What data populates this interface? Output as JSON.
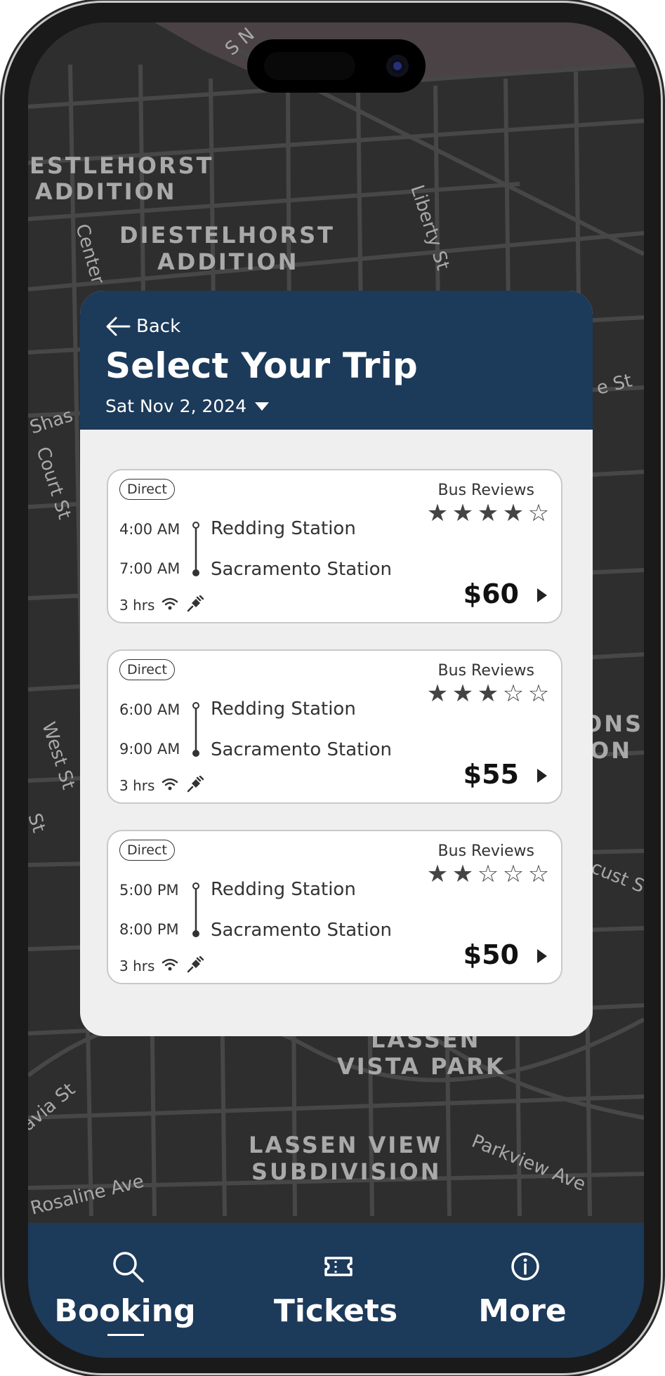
{
  "header": {
    "back_label": "Back",
    "title": "Select Your Trip",
    "date": "Sat Nov 2, 2024"
  },
  "map_labels": {
    "l1": "ESTLEHORST",
    "l2": "ADDITION",
    "l3": "DIESTELHORST",
    "l4": "ADDITION",
    "l5": "Liberty St",
    "l6": "Center",
    "l7": "Shas",
    "l8": "Court St",
    "l9": "West St",
    "l10": "St",
    "l11": "ONS",
    "l12": "ON",
    "l13": "cust S",
    "l14": "e St",
    "l15": "LASSEN",
    "l16": "VISTA PARK",
    "l17": "LASSEN VIEW",
    "l18": "SUBDIVISION",
    "l19": "avia St",
    "l20": "Rosaline Ave",
    "l21": "Parkview Ave",
    "l22": "S N"
  },
  "trips": [
    {
      "badge": "Direct",
      "depart_time": "4:00 AM",
      "arrive_time": "7:00 AM",
      "origin": "Redding Station",
      "destination": "Sacramento Station",
      "duration": "3 hrs",
      "reviews_label": "Bus Reviews",
      "rating": 4,
      "price": "$60"
    },
    {
      "badge": "Direct",
      "depart_time": "6:00 AM",
      "arrive_time": "9:00 AM",
      "origin": "Redding Station",
      "destination": "Sacramento Station",
      "duration": "3 hrs",
      "reviews_label": "Bus Reviews",
      "rating": 3,
      "price": "$55"
    },
    {
      "badge": "Direct",
      "depart_time": "5:00 PM",
      "arrive_time": "8:00 PM",
      "origin": "Redding Station",
      "destination": "Sacramento Station",
      "duration": "3 hrs",
      "reviews_label": "Bus Reviews",
      "rating": 2,
      "price": "$50"
    }
  ],
  "nav": {
    "booking": "Booking",
    "tickets": "Tickets",
    "more": "More",
    "active": "Booking"
  },
  "icons": {
    "back": "arrow-left-icon",
    "date_caret": "caret-down-icon",
    "wifi": "wifi-icon",
    "plug": "power-plug-icon",
    "booking": "search-icon",
    "tickets": "ticket-icon",
    "more": "info-icon"
  },
  "colors": {
    "primary": "#1c3a5a",
    "card_bg": "#efefef",
    "map_bg": "#2e2e2e"
  }
}
